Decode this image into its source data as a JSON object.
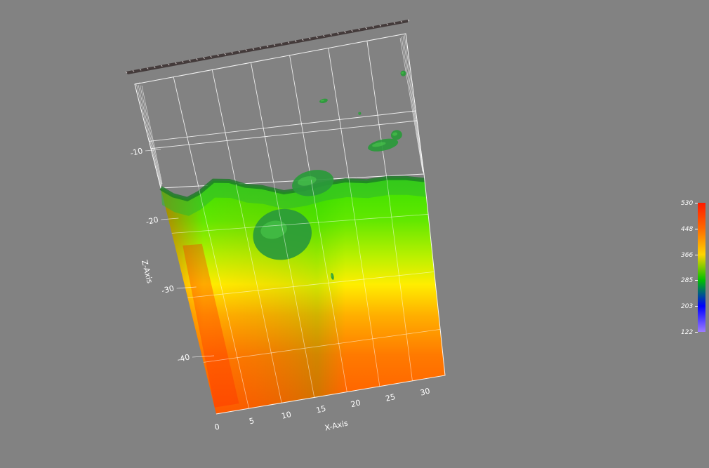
{
  "chart_data": {
    "type": "heatmap",
    "title": "",
    "xlabel": "X-Axis",
    "zlabel": "Z-Axis",
    "x_ticks": [
      "0",
      "5",
      "10",
      "15",
      "20",
      "25",
      "30"
    ],
    "z_ticks": [
      "-10",
      "-20",
      "-30",
      "-40"
    ],
    "xlim": [
      0,
      33
    ],
    "zlim": [
      -48,
      0
    ],
    "colorbar": {
      "ticks": [
        "530",
        "448",
        "366",
        "285",
        "203",
        "122"
      ],
      "min": 122,
      "max": 530,
      "colors": [
        "#ff1a00",
        "#ff6a00",
        "#ffd400",
        "#00c000",
        "#0000ff",
        "#9c7cff"
      ]
    },
    "isosurface_color": "#2a9a3a",
    "grid": true
  }
}
